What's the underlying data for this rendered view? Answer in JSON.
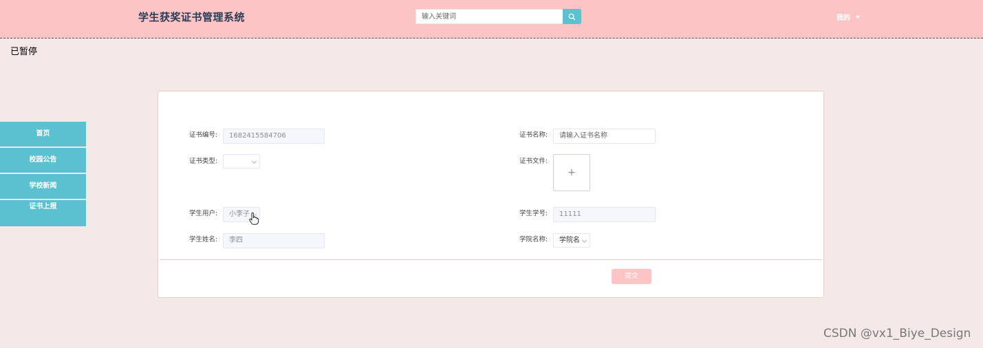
{
  "header": {
    "title": "学生获奖证书管理系统",
    "search_placeholder": "输入关键词",
    "search_icon": "search-icon",
    "user_menu_label": "我的"
  },
  "status": {
    "paused_text": "已暂停"
  },
  "sidebar": {
    "items": [
      {
        "label": "首页"
      },
      {
        "label": "校园公告"
      },
      {
        "label": "学校新闻"
      },
      {
        "label": "证书上报"
      }
    ],
    "active_index": 3
  },
  "form": {
    "cert_no": {
      "label": "证书编号:",
      "value": "1682415584706"
    },
    "cert_name": {
      "label": "证书名称:",
      "placeholder": "请输入证书名称"
    },
    "cert_type": {
      "label": "证书类型:",
      "value": ""
    },
    "cert_file": {
      "label": "证书文件:",
      "upload_symbol": "+"
    },
    "student_user": {
      "label": "学生用户:",
      "value": "小李子"
    },
    "student_no": {
      "label": "学生学号:",
      "value": "11111"
    },
    "student_name": {
      "label": "学生姓名:",
      "value": "李四"
    },
    "college_name": {
      "label": "学院名称:",
      "value": "学院名"
    },
    "submit_label": "提交"
  },
  "colors": {
    "header_bg": "#fcc4c5",
    "accent": "#5bc0cf",
    "page_bg": "#f5e9e8"
  },
  "watermark": "CSDN @vx1_Biye_Design"
}
